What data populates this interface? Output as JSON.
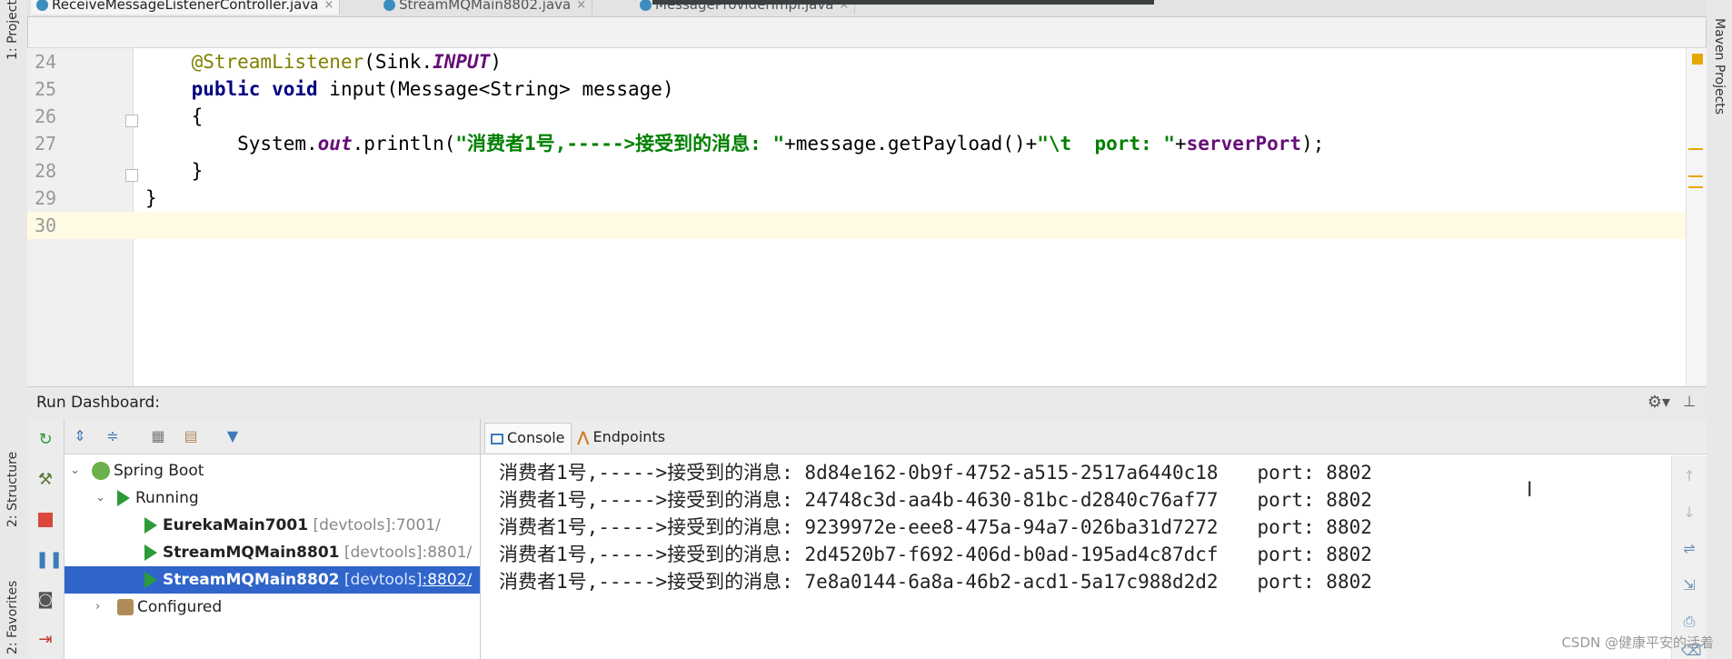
{
  "tabs": [
    {
      "label": "ReceiveMessageListenerController.java",
      "active": true
    },
    {
      "label": "StreamMQMain8802.java",
      "active": false
    },
    {
      "label": "MessageProviderImpl.java",
      "active": false
    }
  ],
  "left_strip": {
    "project_label": "1: Project",
    "structure_label": "2: Structure",
    "favorites_label": "2: Favorites"
  },
  "right_strip": {
    "maven_label": "Maven Projects"
  },
  "editor": {
    "lines": [
      {
        "number": "24",
        "parts": [
          [
            "plain",
            "    "
          ],
          [
            "ann",
            "@StreamListener"
          ],
          [
            "plain",
            "(Sink."
          ],
          [
            "ital",
            "INPUT"
          ],
          [
            "plain",
            ")"
          ]
        ]
      },
      {
        "number": "25",
        "parts": [
          [
            "plain",
            "    "
          ],
          [
            "kw",
            "public void "
          ],
          [
            "plain",
            "input(Message<String> message)"
          ]
        ]
      },
      {
        "number": "26",
        "parts": [
          [
            "plain",
            "    {"
          ]
        ]
      },
      {
        "number": "27",
        "parts": [
          [
            "plain",
            "        System."
          ],
          [
            "ital",
            "out"
          ],
          [
            "plain",
            ".println("
          ],
          [
            "str",
            "\"消费者1号,----->接受到的消息: \""
          ],
          [
            "plain",
            "+message.getPayload()+"
          ],
          [
            "str",
            "\"\\t  port: \""
          ],
          [
            "plain",
            "+"
          ],
          [
            "fld",
            "serverPort"
          ],
          [
            "plain",
            ");"
          ]
        ]
      },
      {
        "number": "28",
        "parts": [
          [
            "plain",
            "    }"
          ]
        ]
      },
      {
        "number": "29",
        "parts": [
          [
            "plain",
            "}"
          ]
        ]
      },
      {
        "number": "30",
        "parts": [
          [
            "plain",
            ""
          ]
        ]
      }
    ],
    "current_line": "30"
  },
  "dashboard": {
    "title": "Run Dashboard:",
    "tree": {
      "root": "Spring Boot",
      "group_running": "Running",
      "apps": [
        {
          "name": "EurekaMain7001",
          "tag": "[devtools]",
          "port": ":7001/",
          "selected": false
        },
        {
          "name": "StreamMQMain8801",
          "tag": "[devtools]",
          "port": ":8801/",
          "selected": false
        },
        {
          "name": "StreamMQMain8802",
          "tag": "[devtools]",
          "port": ":8802/",
          "selected": true
        }
      ],
      "group_configured": "Configured"
    },
    "console_tabs": [
      {
        "label": "Console",
        "active": true
      },
      {
        "label": "Endpoints",
        "active": false
      }
    ],
    "console_lines": [
      "消费者1号,----->接受到的消息: 8d84e162-0b9f-4752-a515-2517a6440c18\t  port: 8802",
      "消费者1号,----->接受到的消息: 24748c3d-aa4b-4630-81bc-d2840c76af77\t  port: 8802",
      "消费者1号,----->接受到的消息: 9239972e-eee8-475a-94a7-026ba31d7272\t  port: 8802",
      "消费者1号,----->接受到的消息: 2d4520b7-f692-406d-b0ad-195ad4c87dcf\t  port: 8802",
      "消费者1号,----->接受到的消息: 7e8a0144-6a8a-46b2-acd1-5a17c988d2d2\t  port: 8802"
    ]
  },
  "watermark": "CSDN @健康平安的活着"
}
